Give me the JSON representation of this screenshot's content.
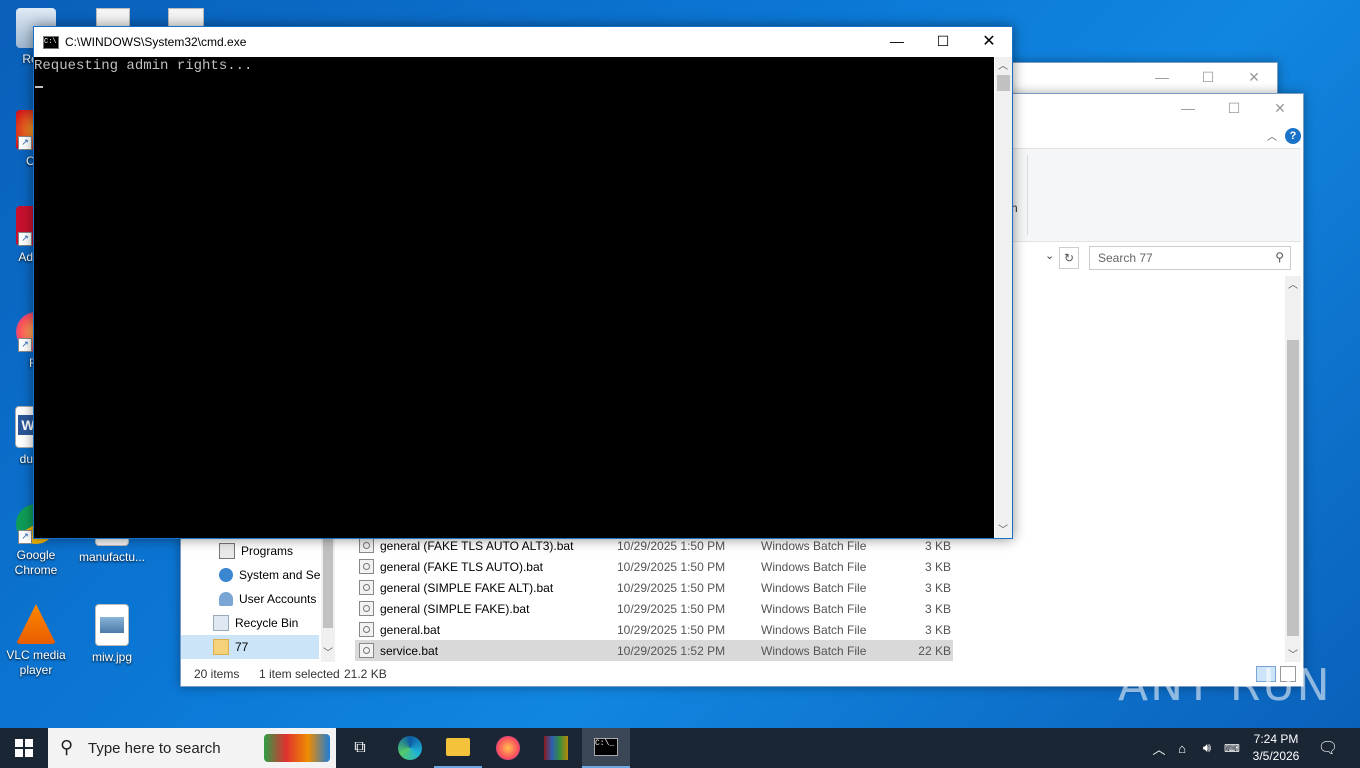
{
  "desktop": {
    "icons": [
      {
        "label": "Recy",
        "icon": "recycle-bin-icon"
      },
      {
        "label": "CCl",
        "icon": "ccleaner-icon"
      },
      {
        "label": "Ad Acr",
        "icon": "acrobat-icon"
      },
      {
        "label": "Fir",
        "icon": "firefox-icon"
      },
      {
        "label": "dueva",
        "icon": "word-doc-icon"
      },
      {
        "label": "Google Chrome",
        "icon": "chrome-icon"
      },
      {
        "label": "manufactu...",
        "icon": "blank-doc-icon"
      },
      {
        "label": "VLC media player",
        "icon": "vlc-icon"
      },
      {
        "label": "miw.jpg",
        "icon": "image-file-icon"
      }
    ]
  },
  "explorer": {
    "search_placeholder": "Search 77",
    "ribbon_fragment": "h",
    "nav": [
      {
        "label": "Programs",
        "icon": "programs-icon"
      },
      {
        "label": "System and Se",
        "icon": "system-icon"
      },
      {
        "label": "User Accounts",
        "icon": "users-icon"
      },
      {
        "label": "Recycle Bin",
        "icon": "recycle-bin-icon"
      },
      {
        "label": "77",
        "icon": "folder-icon"
      }
    ],
    "files": [
      {
        "name": "general (FAKE TLS AUTO ALT3).bat",
        "date": "10/29/2025 1:50 PM",
        "type": "Windows Batch File",
        "size": "3 KB"
      },
      {
        "name": "general (FAKE TLS AUTO).bat",
        "date": "10/29/2025 1:50 PM",
        "type": "Windows Batch File",
        "size": "3 KB"
      },
      {
        "name": "general (SIMPLE FAKE ALT).bat",
        "date": "10/29/2025 1:50 PM",
        "type": "Windows Batch File",
        "size": "3 KB"
      },
      {
        "name": "general (SIMPLE FAKE).bat",
        "date": "10/29/2025 1:50 PM",
        "type": "Windows Batch File",
        "size": "3 KB"
      },
      {
        "name": "general.bat",
        "date": "10/29/2025 1:50 PM",
        "type": "Windows Batch File",
        "size": "3 KB"
      },
      {
        "name": "service.bat",
        "date": "10/29/2025 1:52 PM",
        "type": "Windows Batch File",
        "size": "22 KB",
        "selected": true
      }
    ],
    "status": {
      "items": "20 items",
      "selected": "1 item selected",
      "size": "21.2 KB"
    }
  },
  "cmd": {
    "title": "C:\\WINDOWS\\System32\\cmd.exe",
    "output": "Requesting admin rights..."
  },
  "taskbar": {
    "search_placeholder": "Type here to search",
    "time": "7:24 PM",
    "date": "3/5/2026"
  },
  "watermark": "ANY RUN",
  "colors": {
    "desktop": "#0b78d6",
    "taskbar": "#1b2634",
    "selection": "#d9d9d9"
  }
}
